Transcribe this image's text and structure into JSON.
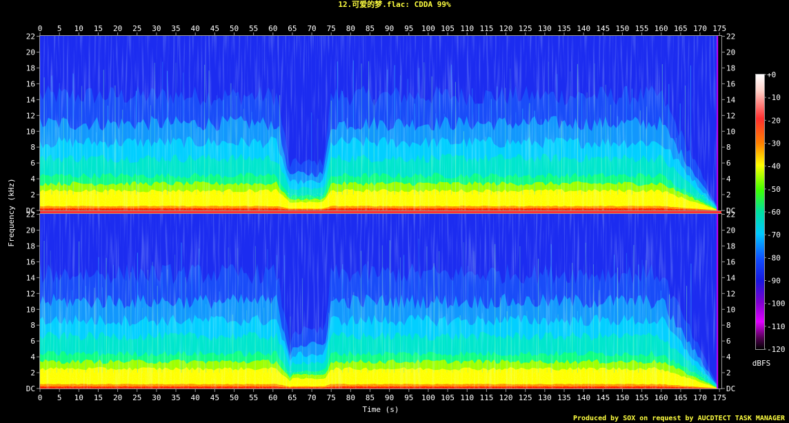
{
  "title": "12.可爱的梦.flac: CDDA 99%",
  "credit": "Produced by SOX on request by AUCDTECT TASK MANAGER",
  "chart_data": {
    "type": "heatmap",
    "subtype": "spectrogram",
    "channels": 2,
    "xlabel": "Time (s)",
    "ylabel": "Frequency (kHz)",
    "colorbar_label": "dBFS",
    "xlim": [
      0,
      175.5
    ],
    "ylim": [
      0,
      22.05
    ],
    "x_ticks": [
      0,
      5,
      10,
      15,
      20,
      25,
      30,
      35,
      40,
      45,
      50,
      55,
      60,
      65,
      70,
      75,
      80,
      85,
      90,
      95,
      100,
      105,
      110,
      115,
      120,
      125,
      130,
      135,
      140,
      145,
      150,
      155,
      160,
      165,
      170,
      175
    ],
    "y_ticks": [
      "DC",
      "2",
      "4",
      "6",
      "8",
      "10",
      "12",
      "14",
      "16",
      "18",
      "20",
      "22"
    ],
    "y_tick_values": [
      0,
      2,
      4,
      6,
      8,
      10,
      12,
      14,
      16,
      18,
      20,
      22
    ],
    "colorbar_ticks": [
      "+0",
      "-10",
      "-20",
      "-30",
      "-40",
      "-50",
      "-60",
      "-70",
      "-80",
      "-90",
      "-100",
      "-110",
      "-120"
    ],
    "colorbar_values": [
      0,
      -10,
      -20,
      -30,
      -40,
      -50,
      -60,
      -70,
      -80,
      -90,
      -100,
      -110,
      -120
    ],
    "colors": {
      "title": "#ffff40",
      "credit": "#ffff40",
      "text": "#ffffff",
      "axis": "#9a9a9a",
      "background": "#000000",
      "colormap": [
        "#ffffff",
        "#ffd0c8",
        "#ff3030",
        "#ff4000",
        "#ffb000",
        "#ffff00",
        "#a0ff00",
        "#00e000",
        "#00ffc0",
        "#00c8ff",
        "#1060ff",
        "#1818e0",
        "#6000c0",
        "#d000ff",
        "#400040",
        "#000000"
      ]
    }
  }
}
